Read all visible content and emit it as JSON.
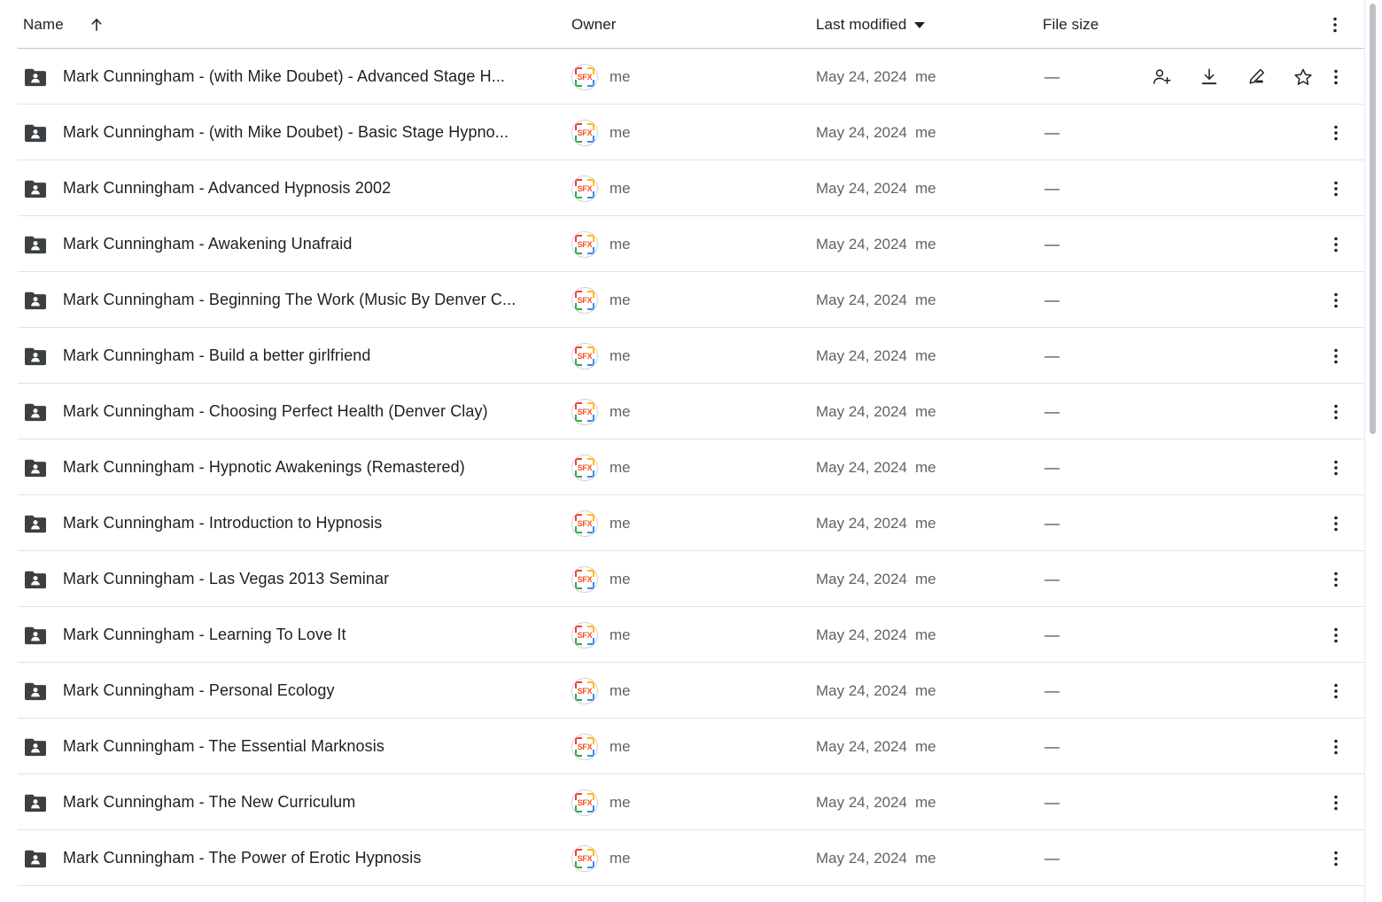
{
  "header": {
    "columns": {
      "name": "Name",
      "owner": "Owner",
      "last_modified": "Last modified",
      "file_size": "File size"
    },
    "sort": {
      "name_direction": "ascending",
      "modified_direction": "descending"
    },
    "icons": {
      "sort_up": "arrow-up-icon",
      "sort_down": "caret-down-icon",
      "more": "more-vertical-icon"
    }
  },
  "row_actions": {
    "share": "person-add-icon",
    "download": "download-icon",
    "edit": "pencil-edit-icon",
    "star": "star-outline-icon",
    "more": "more-vertical-icon"
  },
  "colors": {
    "folder": "#3c4043",
    "divider": "#e3e3e3",
    "header_divider": "#c4c7c5",
    "text_primary": "#1f1f1f",
    "text_secondary": "#5f6368",
    "avatar_brand": "#f4511e",
    "google_red": "#ea4335",
    "google_yellow": "#fbbc04",
    "google_green": "#34a853",
    "google_blue": "#4285f4"
  },
  "avatar": {
    "label": "SFX"
  },
  "rows": [
    {
      "name": "Mark Cunningham - (with Mike Doubet) - Advanced Stage H...",
      "owner": "me",
      "modified_date": "May 24, 2024",
      "modified_by": "me",
      "size": "—",
      "hovered": true
    },
    {
      "name": "Mark Cunningham - (with Mike Doubet) - Basic Stage Hypno...",
      "owner": "me",
      "modified_date": "May 24, 2024",
      "modified_by": "me",
      "size": "—",
      "hovered": false
    },
    {
      "name": "Mark Cunningham - Advanced Hypnosis 2002",
      "owner": "me",
      "modified_date": "May 24, 2024",
      "modified_by": "me",
      "size": "—",
      "hovered": false
    },
    {
      "name": "Mark Cunningham - Awakening Unafraid",
      "owner": "me",
      "modified_date": "May 24, 2024",
      "modified_by": "me",
      "size": "—",
      "hovered": false
    },
    {
      "name": "Mark Cunningham - Beginning The Work (Music By Denver C...",
      "owner": "me",
      "modified_date": "May 24, 2024",
      "modified_by": "me",
      "size": "—",
      "hovered": false
    },
    {
      "name": "Mark Cunningham - Build a better girlfriend",
      "owner": "me",
      "modified_date": "May 24, 2024",
      "modified_by": "me",
      "size": "—",
      "hovered": false
    },
    {
      "name": "Mark Cunningham - Choosing Perfect Health (Denver Clay)",
      "owner": "me",
      "modified_date": "May 24, 2024",
      "modified_by": "me",
      "size": "—",
      "hovered": false
    },
    {
      "name": "Mark Cunningham - Hypnotic Awakenings (Remastered)",
      "owner": "me",
      "modified_date": "May 24, 2024",
      "modified_by": "me",
      "size": "—",
      "hovered": false
    },
    {
      "name": "Mark Cunningham - Introduction to Hypnosis",
      "owner": "me",
      "modified_date": "May 24, 2024",
      "modified_by": "me",
      "size": "—",
      "hovered": false
    },
    {
      "name": "Mark Cunningham - Las Vegas 2013 Seminar",
      "owner": "me",
      "modified_date": "May 24, 2024",
      "modified_by": "me",
      "size": "—",
      "hovered": false
    },
    {
      "name": "Mark Cunningham - Learning To Love It",
      "owner": "me",
      "modified_date": "May 24, 2024",
      "modified_by": "me",
      "size": "—",
      "hovered": false
    },
    {
      "name": "Mark Cunningham - Personal Ecology",
      "owner": "me",
      "modified_date": "May 24, 2024",
      "modified_by": "me",
      "size": "—",
      "hovered": false
    },
    {
      "name": "Mark Cunningham - The Essential Marknosis",
      "owner": "me",
      "modified_date": "May 24, 2024",
      "modified_by": "me",
      "size": "—",
      "hovered": false
    },
    {
      "name": "Mark Cunningham - The New Curriculum",
      "owner": "me",
      "modified_date": "May 24, 2024",
      "modified_by": "me",
      "size": "—",
      "hovered": false
    },
    {
      "name": "Mark Cunningham - The Power of Erotic Hypnosis",
      "owner": "me",
      "modified_date": "May 24, 2024",
      "modified_by": "me",
      "size": "—",
      "hovered": false
    }
  ]
}
